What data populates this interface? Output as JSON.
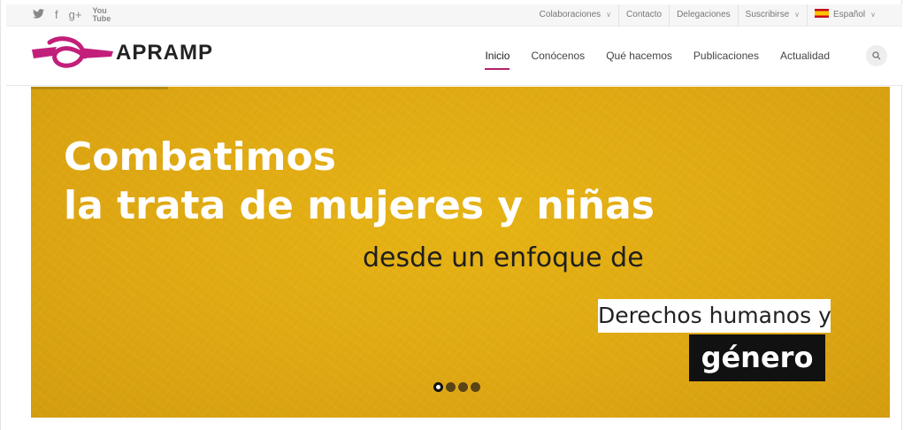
{
  "social": [
    {
      "icon": "twitter-icon",
      "glyph": "🐦"
    },
    {
      "icon": "facebook-icon",
      "glyph": "f"
    },
    {
      "icon": "google-plus-icon",
      "glyph": "g+"
    },
    {
      "icon": "youtube-icon",
      "glyph": "You Tube"
    }
  ],
  "topbar": {
    "links": [
      "Colaboraciones",
      "Contacto",
      "Delegaciones",
      "Suscribirse"
    ],
    "language": "Español"
  },
  "header": {
    "logo_text": "APRAMP",
    "nav": [
      "Inicio",
      "Conócenos",
      "Qué hacemos",
      "Publicaciones",
      "Actualidad"
    ],
    "active_nav": "Inicio"
  },
  "hero": {
    "headline_1": "Combatimos",
    "headline_2": "la trata de mujeres y niñas",
    "subline": "desde un enfoque de",
    "box_white": "Derechos humanos y",
    "box_black": "género",
    "slide_count": 4,
    "active_slide": 1
  },
  "colors": {
    "brand": "#b0246a",
    "hero_bg": "#dfa812"
  }
}
